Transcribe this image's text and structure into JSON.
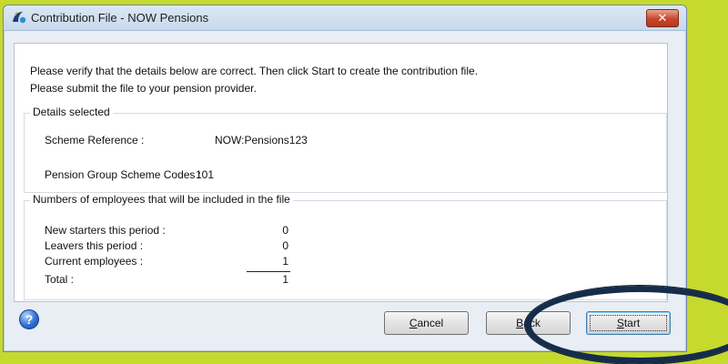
{
  "window": {
    "title": "Contribution File - NOW Pensions",
    "close_label": "✕"
  },
  "intro": {
    "line1": "Please verify that the details below are correct. Then click Start to create the contribution file.",
    "line2": "Please submit the file to your pension provider."
  },
  "details": {
    "legend": "Details selected",
    "scheme_reference_label": "Scheme Reference :",
    "scheme_reference_value": "NOW:Pensions123",
    "group_codes_label": "Pension Group Scheme Codes :",
    "group_codes_value": "101"
  },
  "numbers": {
    "legend": "Numbers of employees that will be included in the file",
    "rows": [
      {
        "label": "New starters this period :",
        "value": "0"
      },
      {
        "label": "Leavers this period :",
        "value": "0"
      },
      {
        "label": "Current employees :",
        "value": "1"
      },
      {
        "label": "Total :",
        "value": "1"
      }
    ]
  },
  "buttons": {
    "help_glyph": "?",
    "cancel_first": "C",
    "cancel_rest": "ancel",
    "back_first": "B",
    "back_rest": "ack",
    "start_first": "S",
    "start_rest": "tart"
  },
  "colors": {
    "accent_highlight": "#152d4a",
    "background": "#c6d92d"
  },
  "icons": [
    "app-icon",
    "close-icon",
    "help-icon"
  ]
}
